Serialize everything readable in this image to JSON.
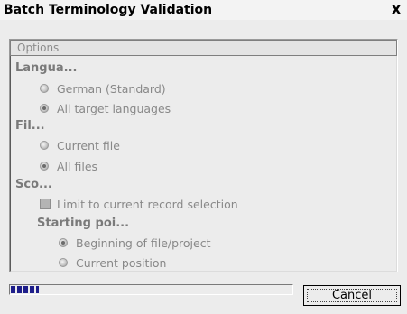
{
  "window": {
    "title": "Batch Terminology Validation",
    "close_symbol": "X"
  },
  "options_header": "Options",
  "groups": {
    "language": {
      "heading": "Langua...",
      "options": [
        {
          "label": "German (Standard)",
          "checked": false
        },
        {
          "label": "All target languages",
          "checked": true
        }
      ]
    },
    "file": {
      "heading": "Fil...",
      "options": [
        {
          "label": "Current file",
          "checked": false
        },
        {
          "label": "All files",
          "checked": true
        }
      ]
    },
    "scope": {
      "heading": "Sco...",
      "limit_checkbox": {
        "label": "Limit to current record selection",
        "checked": false
      },
      "starting_point": {
        "heading": "Starting poi...",
        "options": [
          {
            "label": "Beginning of file/project",
            "checked": true
          },
          {
            "label": "Current position",
            "checked": false
          }
        ]
      }
    }
  },
  "progress": {
    "fraction": 0.1
  },
  "buttons": {
    "cancel": "Cancel"
  },
  "colors": {
    "disabled_text": "#888888",
    "progress_fill": "#1e1e8a"
  }
}
